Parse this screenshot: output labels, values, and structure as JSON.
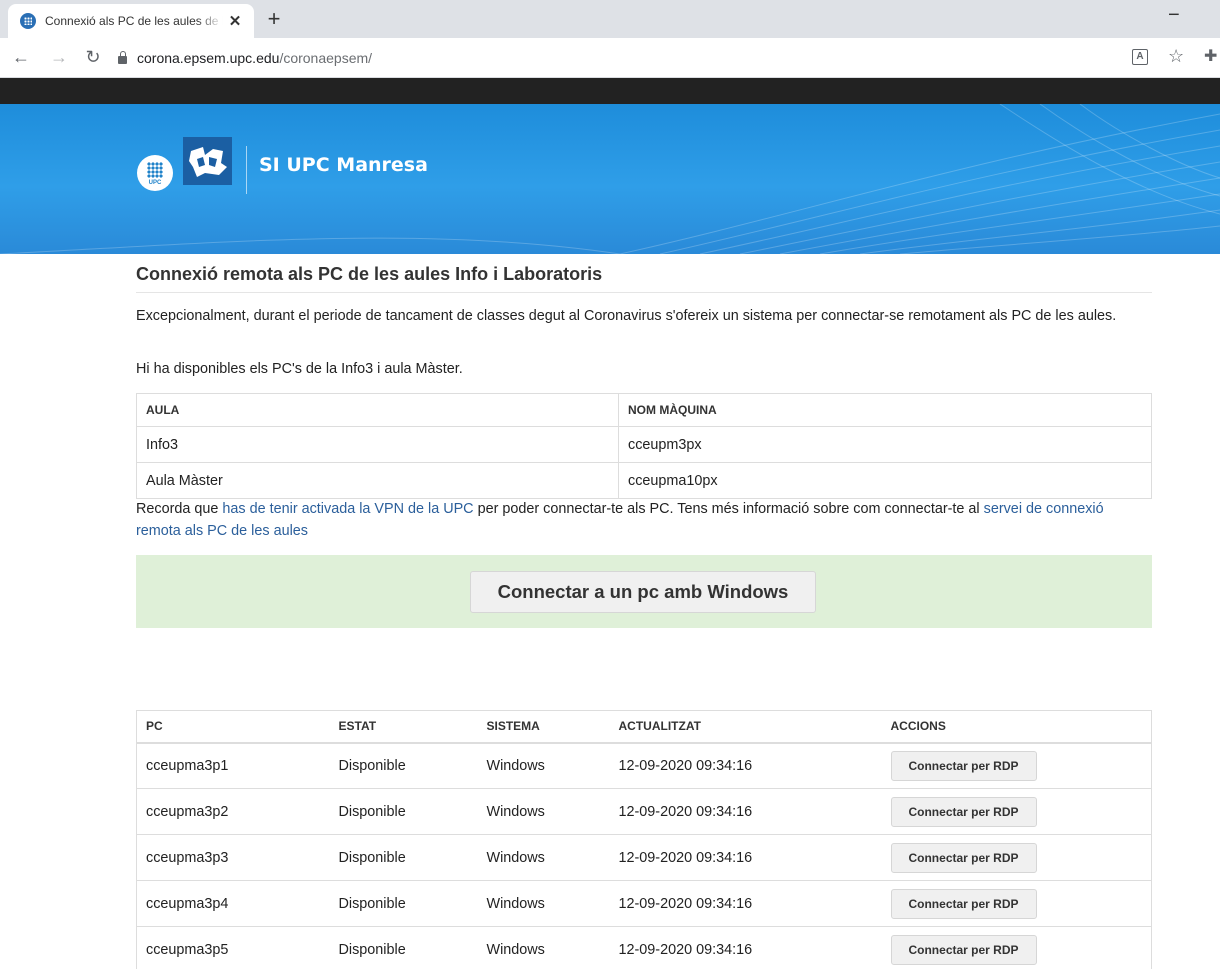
{
  "browser": {
    "tab_title": "Connexió als PC de les aules de la EPSEM",
    "tab_close": "✕",
    "new_tab": "+",
    "minimize": "−",
    "url_host": "corona.epsem.upc.edu",
    "url_path": "/coronaepsem/",
    "icons": [
      "favicon-icon",
      "close-icon",
      "back-icon",
      "forward-icon",
      "reload-icon",
      "lock-icon",
      "translate-icon",
      "star-icon",
      "extensions-icon"
    ]
  },
  "header": {
    "site_title": "SI UPC Manresa",
    "upc_logo_text": "UPC",
    "colors": {
      "banner": "#2f9ee8",
      "topbar": "#222222",
      "panel": "#dff0d8",
      "link": "#2b5f9b"
    }
  },
  "main": {
    "heading": "Connexió remota als PC de les aules Info i Laboratoris",
    "intro": "Excepcionalment, durant el periode de tancament de classes degut al Coronavirus s'ofereix un sistema per connectar-se remotament als PC de les aules.",
    "availability": "Hi ha disponibles els PC's de la Info3 i aula Màster.",
    "rooms_table": {
      "headers": [
        "AULA",
        "NOM MÀQUINA"
      ],
      "rows": [
        [
          "Info3",
          "cceupm3px"
        ],
        [
          "Aula Màster",
          "cceupma10px"
        ]
      ]
    },
    "vpn_note": {
      "text_1": "Recorda que ",
      "link_1": "has de tenir activada la VPN de la UPC",
      "text_2": " per poder connectar-te als PC. Tens més informació sobre com connectar-te al ",
      "link_2": "servei de connexió remota als PC de les aules"
    },
    "connect_button": "Connectar a un pc amb Windows",
    "pcs_table": {
      "headers": [
        "PC",
        "ESTAT",
        "SISTEMA",
        "ACTUALITZAT",
        "ACCIONS"
      ],
      "rows": [
        {
          "pc": "cceupma3p1",
          "status": "Disponible",
          "system": "Windows",
          "updated": "12-09-2020 09:34:16",
          "action": "Connectar per RDP"
        },
        {
          "pc": "cceupma3p2",
          "status": "Disponible",
          "system": "Windows",
          "updated": "12-09-2020 09:34:16",
          "action": "Connectar per RDP"
        },
        {
          "pc": "cceupma3p3",
          "status": "Disponible",
          "system": "Windows",
          "updated": "12-09-2020 09:34:16",
          "action": "Connectar per RDP"
        },
        {
          "pc": "cceupma3p4",
          "status": "Disponible",
          "system": "Windows",
          "updated": "12-09-2020 09:34:16",
          "action": "Connectar per RDP"
        },
        {
          "pc": "cceupma3p5",
          "status": "Disponible",
          "system": "Windows",
          "updated": "12-09-2020 09:34:16",
          "action": "Connectar per RDP"
        }
      ]
    }
  }
}
